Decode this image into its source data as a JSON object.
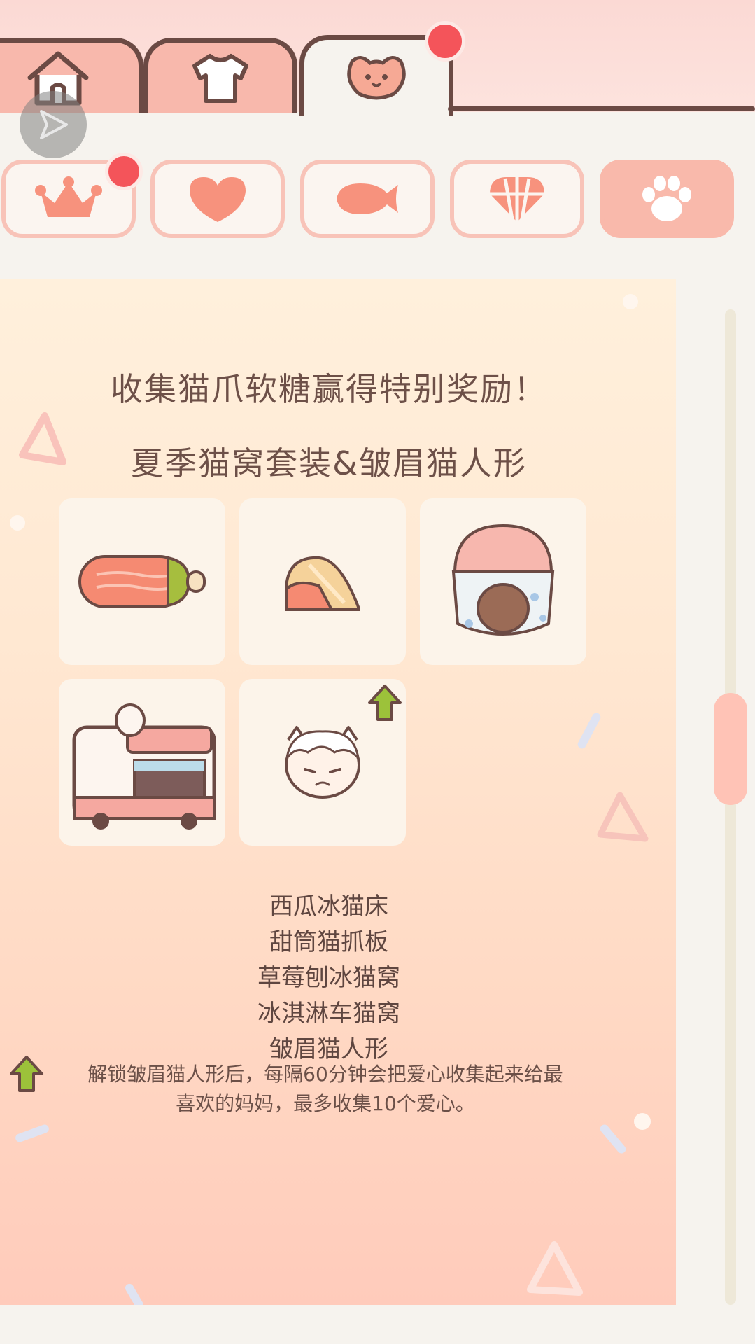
{
  "top_tabs": [
    {
      "name": "home",
      "icon": "house-icon"
    },
    {
      "name": "clothes",
      "icon": "shirt-icon"
    },
    {
      "name": "cat",
      "icon": "cat-face-icon",
      "active": true,
      "badge": true
    }
  ],
  "category_tabs": [
    {
      "icon": "crown-icon",
      "badge": true
    },
    {
      "icon": "heart-icon"
    },
    {
      "icon": "fish-icon"
    },
    {
      "icon": "ball-icon"
    },
    {
      "icon": "paw-icon",
      "active": true
    }
  ],
  "event": {
    "headline": "收集猫爪软糖赢得特别奖励！",
    "subtitle": "夏季猫窝套装&皱眉猫人形",
    "items": [
      {
        "name": "西瓜冰猫床",
        "icon": "watermelon-bed-icon"
      },
      {
        "name": "甜筒猫抓板",
        "icon": "cone-scratcher-icon"
      },
      {
        "name": "草莓刨冰猫窝",
        "icon": "strawberry-ice-house-icon"
      },
      {
        "name": "冰淇淋车猫窝",
        "icon": "ice-cream-truck-icon"
      },
      {
        "name": "皱眉猫人形",
        "icon": "frown-cat-human-icon",
        "upgrade": true
      }
    ],
    "note_line1": "解锁皱眉猫人形后，每隔60分钟会把爱心收集起来给最",
    "note_line2": "喜欢的妈妈，最多收集10个爱心。"
  },
  "colors": {
    "brown": "#6b4a44",
    "pink": "#f8b8ac",
    "badge_red": "#f4545a",
    "arrow_green": "#9cc23a"
  }
}
